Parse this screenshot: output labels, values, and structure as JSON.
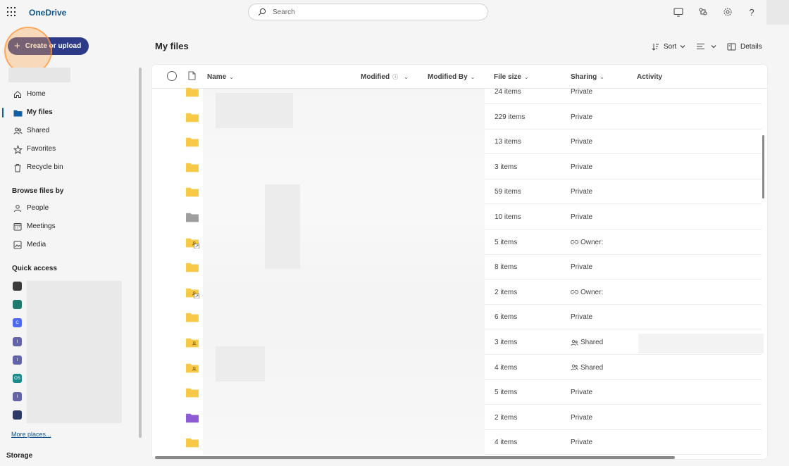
{
  "app": {
    "name": "OneDrive"
  },
  "search": {
    "placeholder": "Search"
  },
  "topbar": {
    "icons": [
      "monitor-icon",
      "share-network-icon",
      "gear-icon",
      "help-icon"
    ]
  },
  "create": {
    "label": "Create or upload"
  },
  "nav": {
    "items": [
      {
        "label": "Home",
        "icon": "home-icon"
      },
      {
        "label": "My files",
        "icon": "folder-icon",
        "active": true
      },
      {
        "label": "Shared",
        "icon": "people-icon"
      },
      {
        "label": "Favorites",
        "icon": "star-icon"
      },
      {
        "label": "Recycle bin",
        "icon": "trash-icon"
      }
    ],
    "browse_heading": "Browse files by",
    "browse": [
      {
        "label": "People",
        "icon": "person-icon"
      },
      {
        "label": "Meetings",
        "icon": "calendar-icon"
      },
      {
        "label": "Media",
        "icon": "image-icon"
      }
    ],
    "quick_access_heading": "Quick access",
    "quick_access": [
      {
        "text": "",
        "color": "#3b3b3b"
      },
      {
        "text": "",
        "color": "#1f7a6e"
      },
      {
        "text": "C",
        "color": "#4f6bed"
      },
      {
        "text": "I",
        "color": "#6264a7"
      },
      {
        "text": "I",
        "color": "#6264a7"
      },
      {
        "text": "OS",
        "color": "#1a8a8a"
      },
      {
        "text": "I",
        "color": "#6264a7"
      },
      {
        "text": "",
        "color": "#2b3a67"
      }
    ],
    "more_places": "More places...",
    "storage": "Storage"
  },
  "main": {
    "title": "My files",
    "commands": {
      "sort": "Sort",
      "details": "Details"
    }
  },
  "columns": {
    "name": "Name",
    "modified": "Modified",
    "modified_by": "Modified By",
    "file_size": "File size",
    "sharing": "Sharing",
    "activity": "Activity"
  },
  "rows": [
    {
      "size": "24 items",
      "sharing": "Private",
      "folder": "yellow"
    },
    {
      "size": "229 items",
      "sharing": "Private",
      "folder": "yellow"
    },
    {
      "size": "13 items",
      "sharing": "Private",
      "folder": "yellow"
    },
    {
      "size": "3 items",
      "sharing": "Private",
      "folder": "yellow"
    },
    {
      "size": "59 items",
      "sharing": "Private",
      "folder": "yellow"
    },
    {
      "size": "10 items",
      "sharing": "Private",
      "folder": "gray"
    },
    {
      "size": "5 items",
      "sharing": "Owner:",
      "folder": "shared-link",
      "share_icon": "link"
    },
    {
      "size": "8 items",
      "sharing": "Private",
      "folder": "yellow"
    },
    {
      "size": "2 items",
      "sharing": "Owner:",
      "folder": "shared-link",
      "share_icon": "link"
    },
    {
      "size": "6 items",
      "sharing": "Private",
      "folder": "yellow"
    },
    {
      "size": "3 items",
      "sharing": "Shared",
      "folder": "shared",
      "share_icon": "people"
    },
    {
      "size": "4 items",
      "sharing": "Shared",
      "folder": "shared",
      "share_icon": "people"
    },
    {
      "size": "5 items",
      "sharing": "Private",
      "folder": "yellow"
    },
    {
      "size": "2 items",
      "sharing": "Private",
      "folder": "purple"
    },
    {
      "size": "4 items",
      "sharing": "Private",
      "folder": "yellow"
    }
  ],
  "colors": {
    "brand": "#0f548c",
    "create_button": "#2c3a87",
    "folder_yellow": "#f7c948",
    "folder_gray": "#9e9e9e",
    "folder_purple": "#8e5bd4"
  }
}
